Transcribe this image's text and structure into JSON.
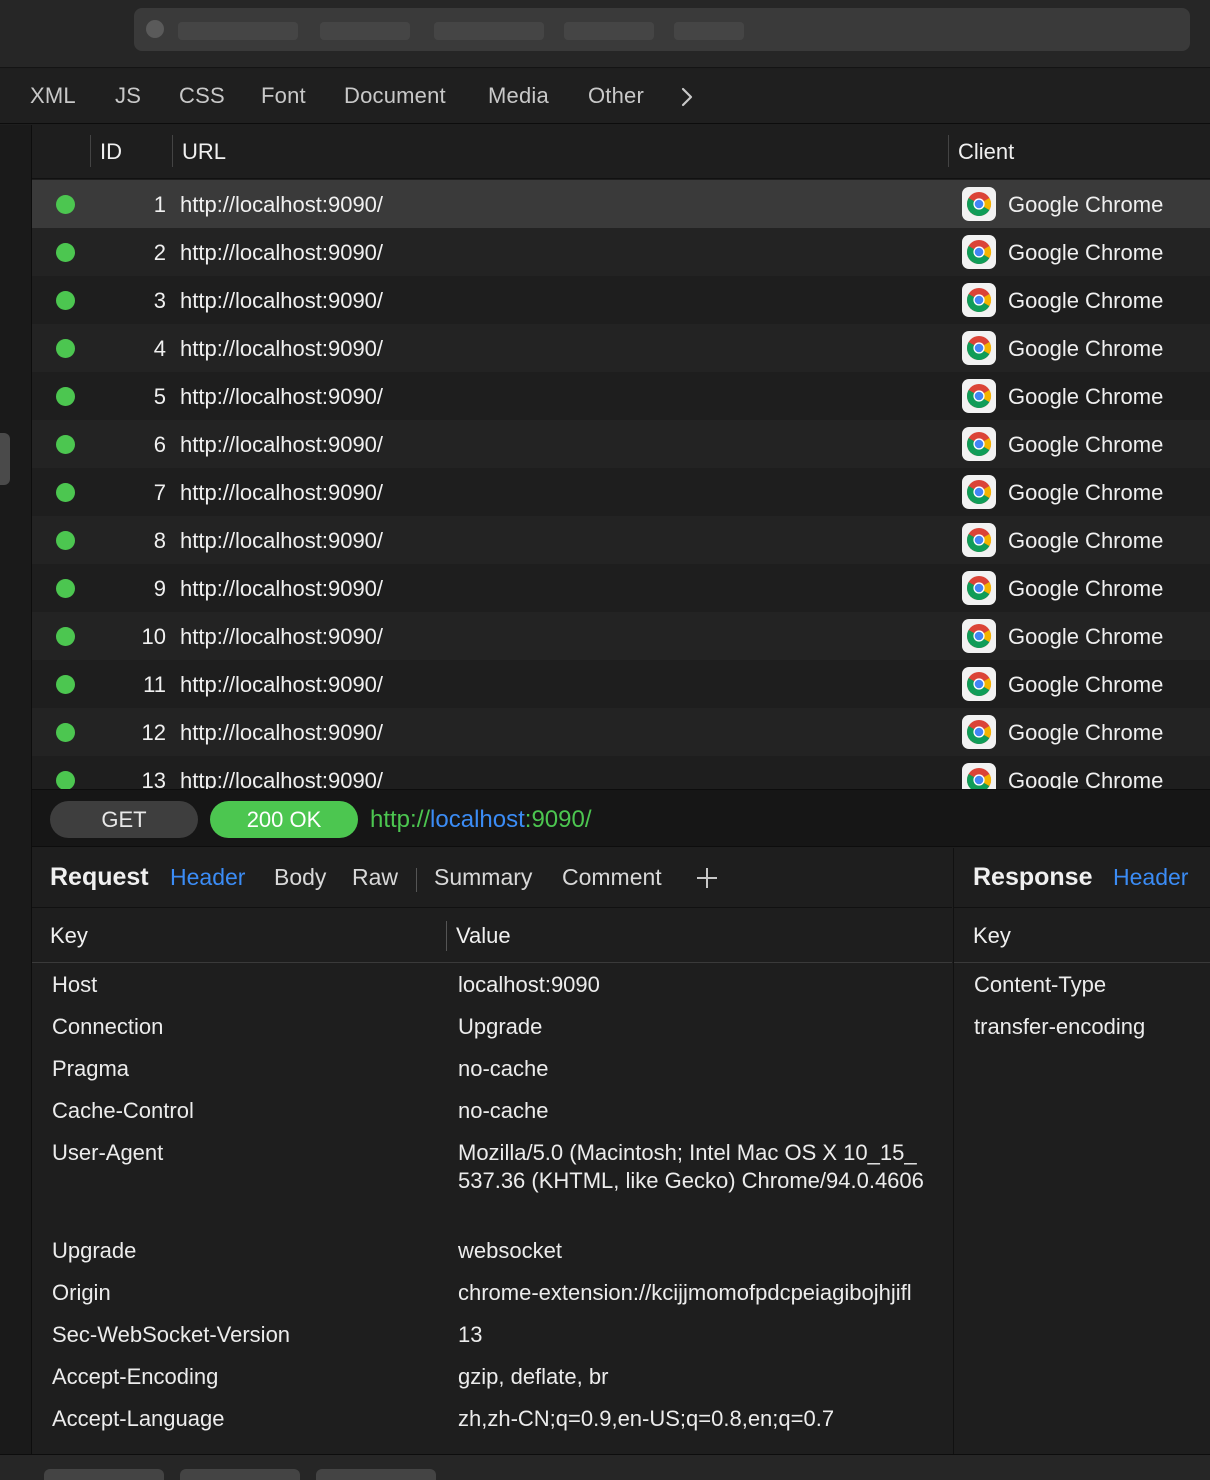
{
  "tabs": [
    "XML",
    "JS",
    "CSS",
    "Font",
    "Document",
    "Media",
    "Other"
  ],
  "table": {
    "columns": {
      "id": "ID",
      "url": "URL",
      "client": "Client"
    },
    "rows": [
      {
        "id": "1",
        "url": "http://localhost:9090/",
        "client": "Google Chrome",
        "status_color": "#4cc650"
      },
      {
        "id": "2",
        "url": "http://localhost:9090/",
        "client": "Google Chrome",
        "status_color": "#4cc650"
      },
      {
        "id": "3",
        "url": "http://localhost:9090/",
        "client": "Google Chrome",
        "status_color": "#4cc650"
      },
      {
        "id": "4",
        "url": "http://localhost:9090/",
        "client": "Google Chrome",
        "status_color": "#4cc650"
      },
      {
        "id": "5",
        "url": "http://localhost:9090/",
        "client": "Google Chrome",
        "status_color": "#4cc650"
      },
      {
        "id": "6",
        "url": "http://localhost:9090/",
        "client": "Google Chrome",
        "status_color": "#4cc650"
      },
      {
        "id": "7",
        "url": "http://localhost:9090/",
        "client": "Google Chrome",
        "status_color": "#4cc650"
      },
      {
        "id": "8",
        "url": "http://localhost:9090/",
        "client": "Google Chrome",
        "status_color": "#4cc650"
      },
      {
        "id": "9",
        "url": "http://localhost:9090/",
        "client": "Google Chrome",
        "status_color": "#4cc650"
      },
      {
        "id": "10",
        "url": "http://localhost:9090/",
        "client": "Google Chrome",
        "status_color": "#4cc650"
      },
      {
        "id": "11",
        "url": "http://localhost:9090/",
        "client": "Google Chrome",
        "status_color": "#4cc650"
      },
      {
        "id": "12",
        "url": "http://localhost:9090/",
        "client": "Google Chrome",
        "status_color": "#4cc650"
      },
      {
        "id": "13",
        "url": "http://localhost:9090/",
        "client": "Google Chrome",
        "status_color": "#4cc650"
      }
    ]
  },
  "request_line": {
    "method": "GET",
    "status": "200 OK",
    "url_scheme": "http://",
    "url_host": "localhost",
    "url_rest": ":9090/"
  },
  "request_panel": {
    "title": "Request",
    "tabs": [
      "Header",
      "Body",
      "Raw",
      "Summary",
      "Comment"
    ],
    "active_tab": "Header",
    "add_label": "+",
    "key_header": "Key",
    "value_header": "Value",
    "headers": [
      {
        "key": "Host",
        "value": "localhost:9090"
      },
      {
        "key": "Connection",
        "value": "Upgrade"
      },
      {
        "key": "Pragma",
        "value": "no-cache"
      },
      {
        "key": "Cache-Control",
        "value": "no-cache"
      },
      {
        "key": "User-Agent",
        "value": "Mozilla/5.0 (Macintosh; Intel Mac OS X 10_15_",
        "value2": "537.36 (KHTML, like Gecko) Chrome/94.0.4606"
      },
      {
        "key": "Upgrade",
        "value": "websocket"
      },
      {
        "key": "Origin",
        "value": "chrome-extension://kcijjmomofpdcpeiagibojhjifl"
      },
      {
        "key": "Sec-WebSocket-Version",
        "value": "13"
      },
      {
        "key": "Accept-Encoding",
        "value": "gzip, deflate, br"
      },
      {
        "key": "Accept-Language",
        "value": "zh,zh-CN;q=0.9,en-US;q=0.8,en;q=0.7"
      }
    ]
  },
  "response_panel": {
    "title": "Response",
    "active_tab": "Header",
    "key_header": "Key",
    "headers": [
      {
        "key": "Content-Type"
      },
      {
        "key": "transfer-encoding"
      }
    ]
  },
  "colors": {
    "accent_blue": "#3b8cf5",
    "success_green": "#4cc650",
    "background": "#1e1e1e"
  },
  "icons": {
    "client": "chrome-icon",
    "more_tabs": "chevron-right-icon",
    "add_tab": "plus-icon"
  }
}
